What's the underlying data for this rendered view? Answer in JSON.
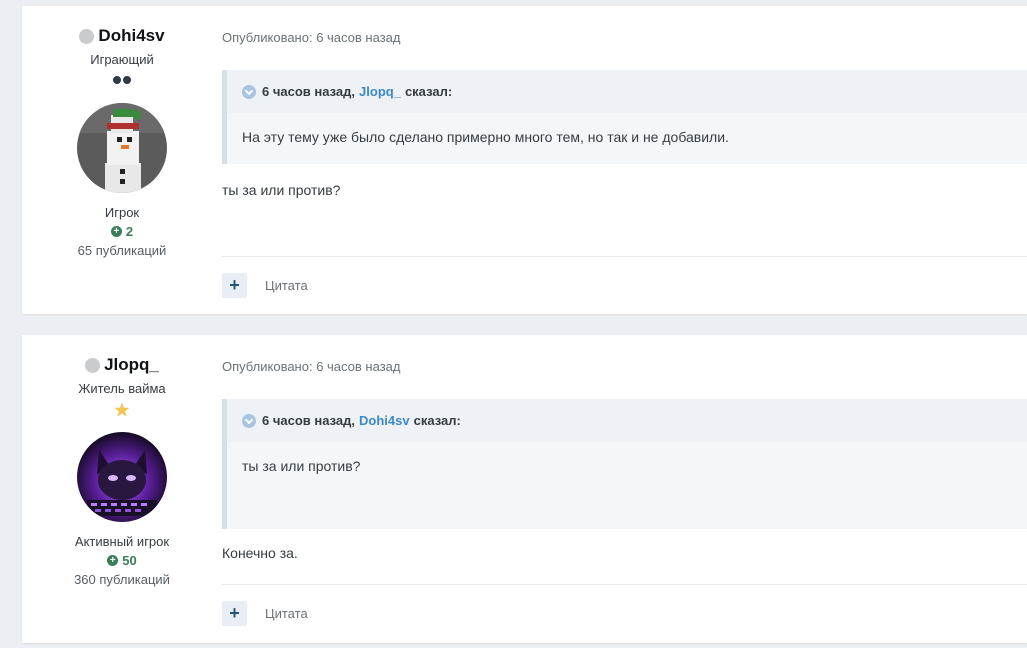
{
  "posts": [
    {
      "author": {
        "name": "Dohi4sv",
        "title": "Играющий",
        "group": "Игрок",
        "reputation": "2",
        "post_count": "65 публикаций"
      },
      "meta": "Опубликовано: 6 часов назад",
      "quote": {
        "time": "6 часов назад,",
        "user": "Jlopq_",
        "said": "сказал:",
        "text": "На эту тему уже было сделано примерно много тем, но так и не добавили."
      },
      "text": "ты за или против?",
      "actions": {
        "plus": "+",
        "quote": "Цитата"
      }
    },
    {
      "author": {
        "name": "Jlopq_",
        "title": "Житель вайма",
        "group": "Активный игрок",
        "reputation": "50",
        "post_count": "360 публикаций"
      },
      "meta": "Опубликовано: 6 часов назад",
      "quote": {
        "time": "6 часов назад,",
        "user": "Dohi4sv",
        "said": "сказал:",
        "text": "ты за или против?"
      },
      "text": "Конечно за.",
      "actions": {
        "plus": "+",
        "quote": "Цитата"
      }
    }
  ],
  "colors": {
    "background": "#ebeef2",
    "link": "#3d89c6",
    "reputation": "#3a7d5a",
    "quote_bg": "#f4f7fa"
  }
}
